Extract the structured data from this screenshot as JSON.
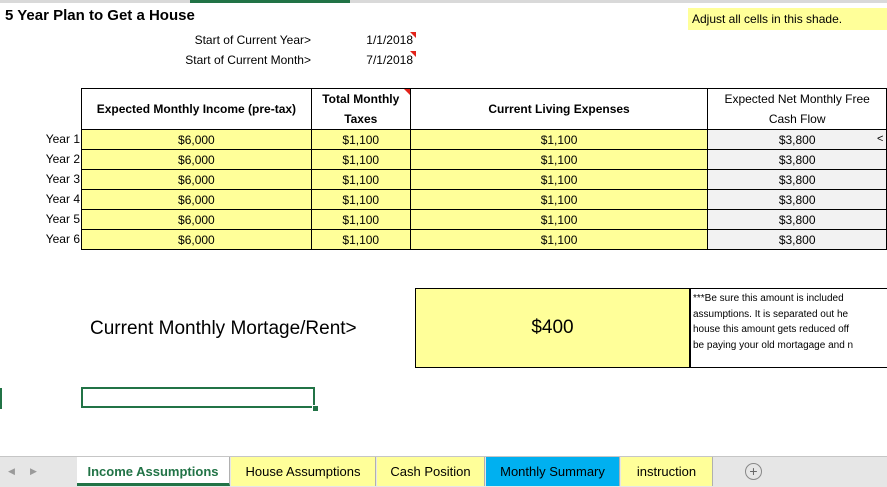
{
  "sheet": {
    "title": "5 Year Plan to Get a House",
    "note": "Adjust all cells in this shade.",
    "start_year_label": "Start of Current Year>",
    "start_year_value": "1/1/2018",
    "start_month_label": "Start of Current Month>",
    "start_month_value": "7/1/2018",
    "headers": {
      "income": "Expected Monthly Income (pre-tax)",
      "taxes_line1": "Total Monthly",
      "taxes_line2": "Taxes",
      "expenses": "Current Living Expenses",
      "cash_line1": "Expected Net Monthly Free",
      "cash_line2": "Cash Flow"
    },
    "rows": [
      {
        "label": "Year 1",
        "income": "$6,000",
        "taxes": "$1,100",
        "expenses": "$1,100",
        "cash": "$3,800"
      },
      {
        "label": "Year 2",
        "income": "$6,000",
        "taxes": "$1,100",
        "expenses": "$1,100",
        "cash": "$3,800"
      },
      {
        "label": "Year 3",
        "income": "$6,000",
        "taxes": "$1,100",
        "expenses": "$1,100",
        "cash": "$3,800"
      },
      {
        "label": "Year 4",
        "income": "$6,000",
        "taxes": "$1,100",
        "expenses": "$1,100",
        "cash": "$3,800"
      },
      {
        "label": "Year 5",
        "income": "$6,000",
        "taxes": "$1,100",
        "expenses": "$1,100",
        "cash": "$3,800"
      },
      {
        "label": "Year 6",
        "income": "$6,000",
        "taxes": "$1,100",
        "expenses": "$1,100",
        "cash": "$3,800"
      }
    ],
    "arrow_cut": "<",
    "mortgage_label": "Current Monthly Mortage/Rent>",
    "mortgage_value": "$400",
    "side_note_lines": [
      "***Be sure this amount is included",
      "assumptions. It is separated out he",
      "house this amount gets reduced off",
      "be paying your old mortagage and n"
    ]
  },
  "tabs": [
    {
      "label": "Income Assumptions",
      "state": "active"
    },
    {
      "label": "House Assumptions",
      "state": "yellow"
    },
    {
      "label": "Cash Position",
      "state": "yellow"
    },
    {
      "label": "Monthly Summary",
      "state": "blue"
    },
    {
      "label": "instruction",
      "state": "yellow"
    }
  ],
  "nav": {
    "prev_icon": "scroll-left-icon",
    "next_icon": "scroll-right-icon",
    "add_icon": "add-sheet-icon",
    "add_symbol": "+"
  },
  "colors": {
    "input_fill": "#ffff99",
    "calc_fill": "#f2f2f2",
    "accent": "#217346",
    "blue_tab": "#00b0f0"
  }
}
